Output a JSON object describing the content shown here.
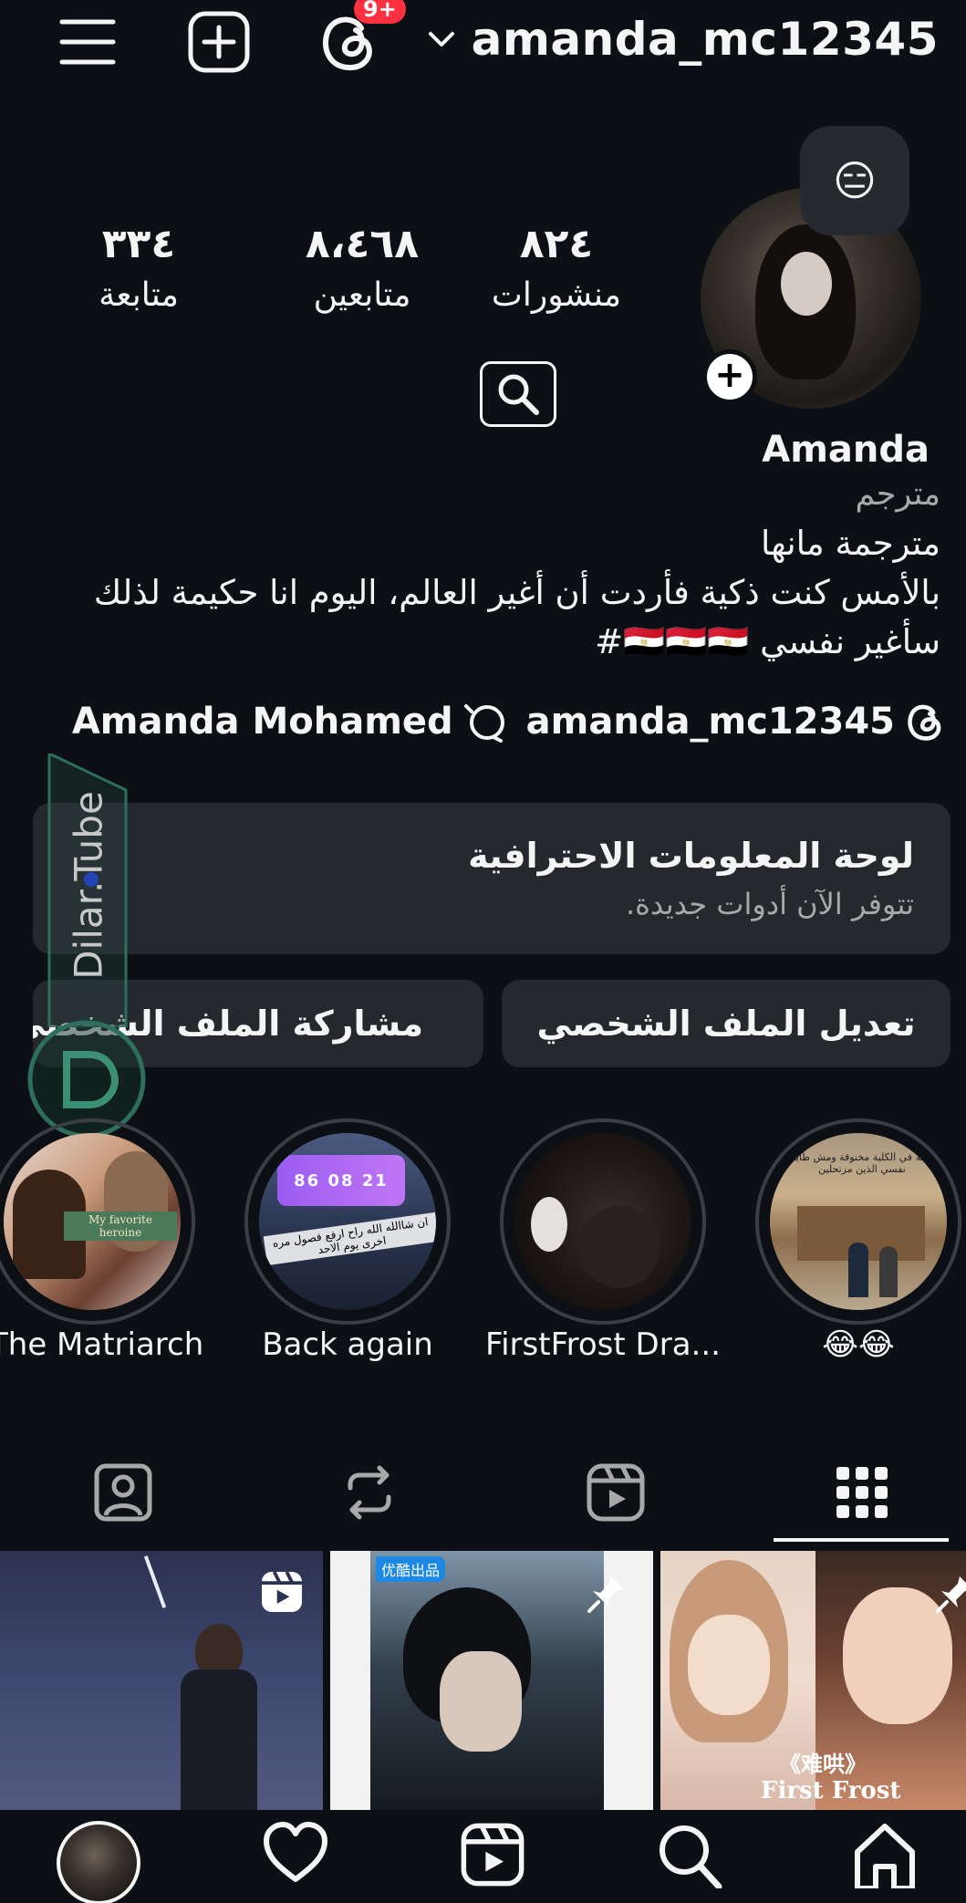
{
  "header": {
    "username": "amanda_mc12345",
    "threads_badge": "9+"
  },
  "profile": {
    "note_emoji": "😑",
    "stats": [
      {
        "value": "٨٢٤",
        "label": "منشورات"
      },
      {
        "value": "٨،٤٦٨",
        "label": "متابعين"
      },
      {
        "value": "٣٣٤",
        "label": "متابعة"
      }
    ],
    "display_name": "Amanda",
    "category": "مترجم",
    "bio": [
      "مترجمة مانها",
      "بالأمس كنت ذكية فأردت أن أغير العالم، اليوم انا حكيمة لذلك",
      "سأغير نفسي 🇪🇬🇪🇬🇪🇬#"
    ],
    "threads_link": "amanda_mc12345",
    "facebook_link": "Amanda Mohamed"
  },
  "dashboard": {
    "title": "لوحة المعلومات الاحترافية",
    "subtitle": "تتوفر الآن أدوات جديدة."
  },
  "buttons": {
    "edit_profile": "تعديل الملف الشخصي",
    "share_profile": "مشاركة الملف الشخصي"
  },
  "watermark": "Dilar.Tube",
  "highlights": [
    {
      "label": "😂😂"
    },
    {
      "label": "FirstFrost Dra..."
    },
    {
      "label": "Back again"
    },
    {
      "label": "The Matriarch"
    }
  ],
  "highlight_texts": {
    "matriarch_caption": "My favorite heroine",
    "back_again_timer": "86 08 21",
    "back_again_caption": "ان شاالله الله راح ارفع فصول مره اخرى يوم الاحد",
    "emoji_caption": "واقفة في الكلية مخنوقة ومش طايقة نفسي الذين مزتحلين"
  },
  "grid": [
    {
      "type": "reel"
    },
    {
      "type": "pinned",
      "tag": "优酷出品"
    },
    {
      "type": "pinned",
      "caption_cn": "《难哄》",
      "caption": "First Frost"
    }
  ],
  "colors": {
    "background": "#0c1014",
    "card": "#25292e",
    "badge": "#ff3040",
    "secondary_text": "#a8a8a8"
  }
}
